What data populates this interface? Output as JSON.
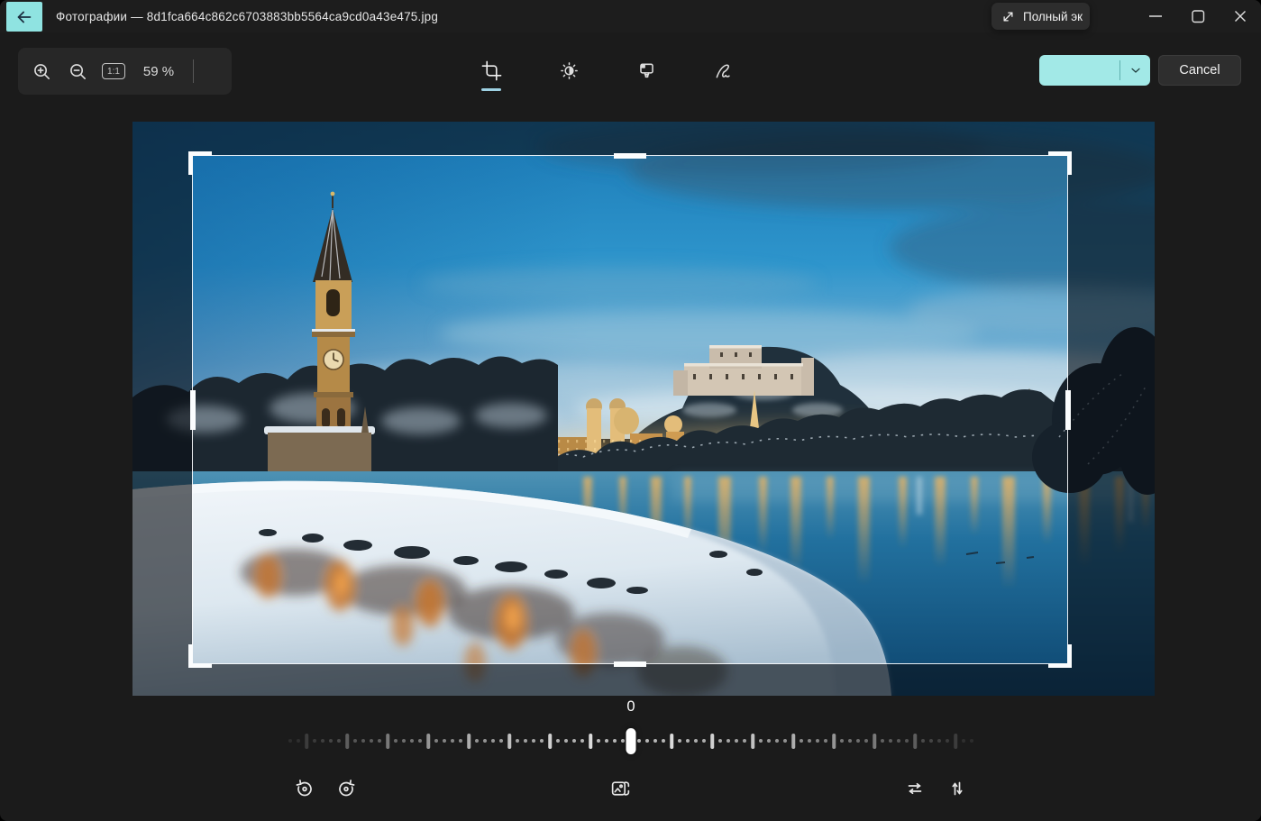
{
  "titlebar": {
    "title": "Фотографии — 8d1fca664c862c6703883bb5564ca9cd0a43e475.jpg",
    "fullscreen_button": "Полный эк"
  },
  "edit_toolbar": {
    "zoom_level": "59 %",
    "one_to_one": "1:1"
  },
  "tools": {
    "selected": "crop"
  },
  "actions": {
    "cancel": "Cancel"
  },
  "straighten": {
    "value": "0",
    "tick_count": 85,
    "major_every": 5
  },
  "photo": {
    "alt": "Snow-covered riverside old town at dusk: lit fortress on a hill, church tower with spire, golden lights reflected in a blue river, snowy bank in foreground"
  },
  "colors": {
    "accent_teal": "#a2e9e7",
    "back_button_teal": "#8fe3e1",
    "selected_underline": "#9ed1e3"
  },
  "icons": {
    "titlebar": [
      "back-icon",
      "fullscreen-expand-icon",
      "minimize-icon",
      "maximize-icon",
      "close-icon"
    ],
    "edit_toolbar": [
      "zoom-in-icon",
      "zoom-out-icon",
      "one-to-one-icon",
      "crop-icon",
      "brightness-adjust-icon",
      "filter-icon",
      "draw-icon",
      "chevron-down-icon"
    ],
    "bottom_toolbar": [
      "rotate-ccw-icon",
      "rotate-cw-icon",
      "aspect-ratio-icon",
      "flip-horizontal-icon",
      "flip-vertical-icon"
    ]
  }
}
